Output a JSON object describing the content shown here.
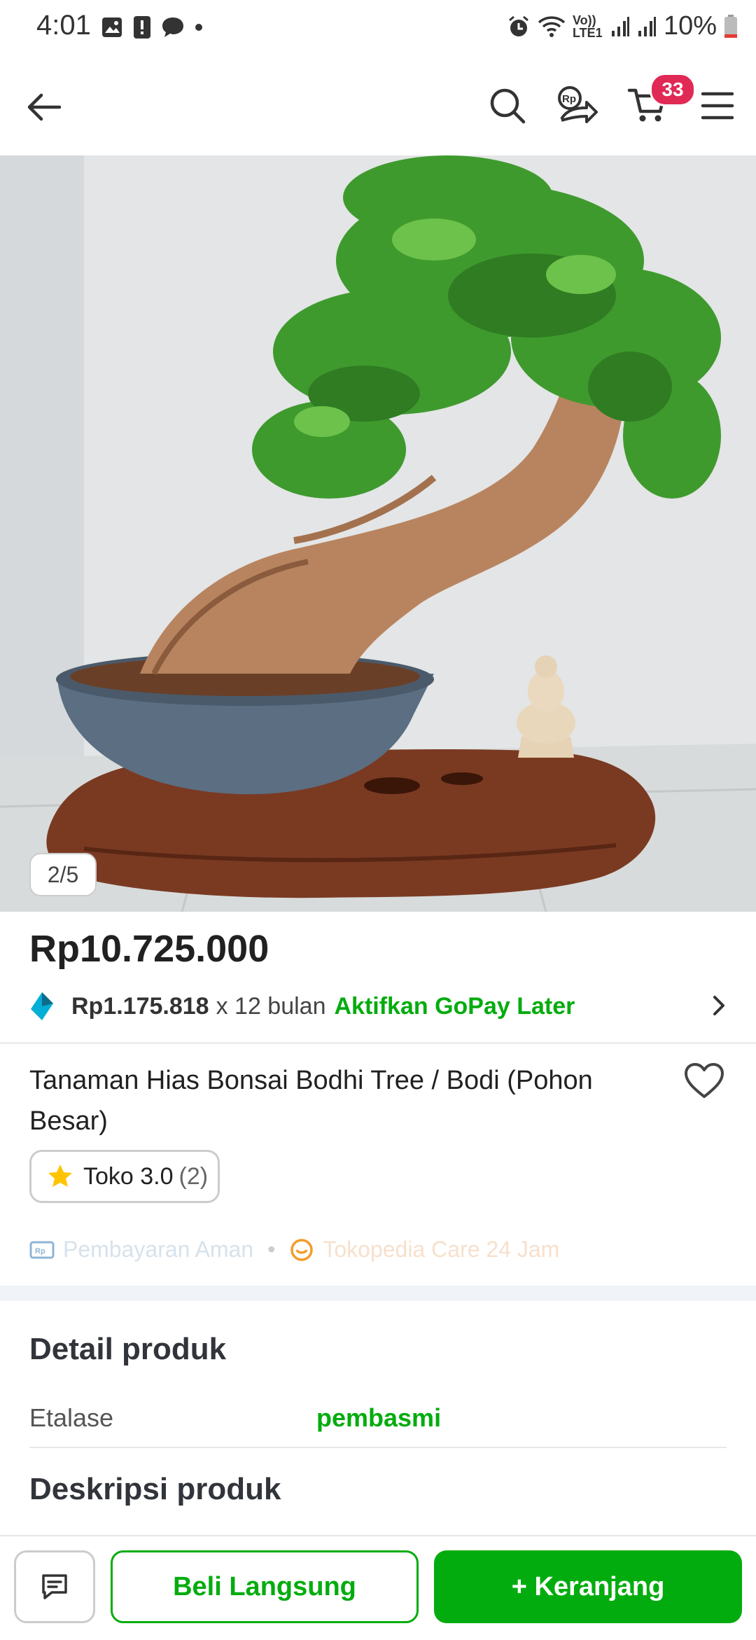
{
  "status_bar": {
    "time": "4:01",
    "battery": "10%",
    "network": "Vo)) LTE1"
  },
  "app_bar": {
    "cart_count": "33",
    "icons": [
      "back-arrow-icon",
      "search-icon",
      "rp-share-icon",
      "cart-icon",
      "menu-icon"
    ]
  },
  "gallery": {
    "counter": "2/5"
  },
  "product": {
    "price": "Rp10.725.000",
    "installment_amount": "Rp1.175.818",
    "installment_term": "x 12 bulan",
    "installment_cta": "Aktifkan GoPay Later",
    "title": "Tanaman Hias Bonsai Bodhi Tree / Bodi (Pohon Besar)",
    "rating_label": "Toko 3.0",
    "rating_count": "(2)"
  },
  "guarantees": {
    "payment": "Pembayaran Aman",
    "care": "Tokopedia Care 24 Jam"
  },
  "details": {
    "heading": "Detail produk",
    "etalase_key": "Etalase",
    "etalase_value": "pembasmi",
    "description_heading": "Deskripsi produk"
  },
  "bottom_bar": {
    "buy_label": "Beli Langsung",
    "cart_label": "+ Keranjang"
  },
  "colors": {
    "primary_green": "#03ac0e",
    "badge_red": "#e02954"
  }
}
